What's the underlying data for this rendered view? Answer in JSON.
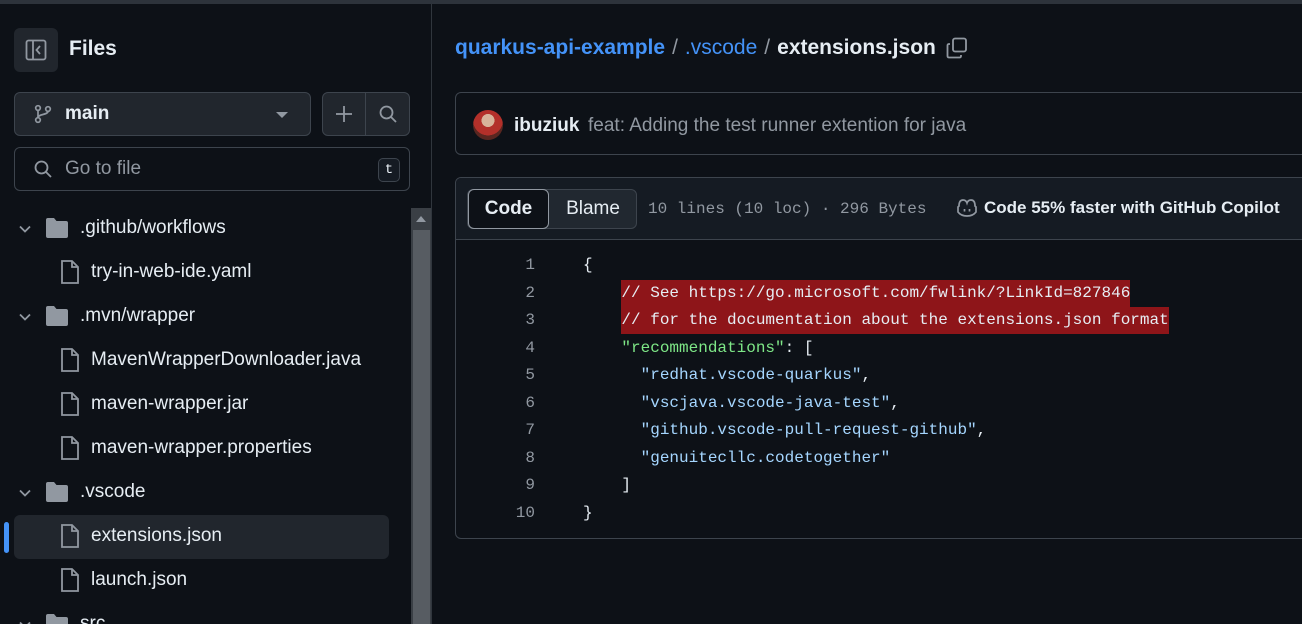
{
  "sidebar": {
    "title": "Files",
    "branch": "main",
    "goto_placeholder": "Go to file",
    "goto_shortcut": "t",
    "tree": [
      {
        "type": "folder",
        "label": ".github/workflows"
      },
      {
        "type": "file",
        "label": "try-in-web-ide.yaml"
      },
      {
        "type": "folder",
        "label": ".mvn/wrapper"
      },
      {
        "type": "file",
        "label": "MavenWrapperDownloader.java"
      },
      {
        "type": "file",
        "label": "maven-wrapper.jar"
      },
      {
        "type": "file",
        "label": "maven-wrapper.properties"
      },
      {
        "type": "folder",
        "label": ".vscode"
      },
      {
        "type": "file",
        "label": "extensions.json",
        "selected": true
      },
      {
        "type": "file",
        "label": "launch.json"
      },
      {
        "type": "folder",
        "label": "src"
      }
    ]
  },
  "breadcrumb": {
    "repo": "quarkus-api-example",
    "sep1": "/",
    "folder": ".vscode",
    "sep2": "/",
    "file": "extensions.json"
  },
  "commit": {
    "user": "ibuziuk",
    "message": "feat: Adding the test runner extention for java"
  },
  "code_view": {
    "tab_code": "Code",
    "tab_blame": "Blame",
    "meta": "10 lines (10 loc) · 296 Bytes",
    "copilot": "Code 55% faster with GitHub Copilot",
    "lines": [
      {
        "n": "1",
        "text": "{"
      },
      {
        "n": "2",
        "text": "    // See https://go.microsoft.com/fwlink/?LinkId=827846"
      },
      {
        "n": "3",
        "text": "    // for the documentation about the extensions.json format"
      },
      {
        "n": "4",
        "key": "\"recommendations\"",
        "rest": ": ["
      },
      {
        "n": "5",
        "str": "\"redhat.vscode-quarkus\"",
        "rest": ","
      },
      {
        "n": "6",
        "str": "\"vscjava.vscode-java-test\"",
        "rest": ","
      },
      {
        "n": "7",
        "str": "\"github.vscode-pull-request-github\"",
        "rest": ","
      },
      {
        "n": "8",
        "str": "\"genuitecllc.codetogether\"",
        "rest": ""
      },
      {
        "n": "9",
        "text": "    ]"
      },
      {
        "n": "10",
        "text": "}"
      }
    ]
  },
  "colors": {
    "accent": "#4493f8",
    "highlight": "#8e1519",
    "string": "#a5d6ff",
    "key": "#7ee787"
  }
}
